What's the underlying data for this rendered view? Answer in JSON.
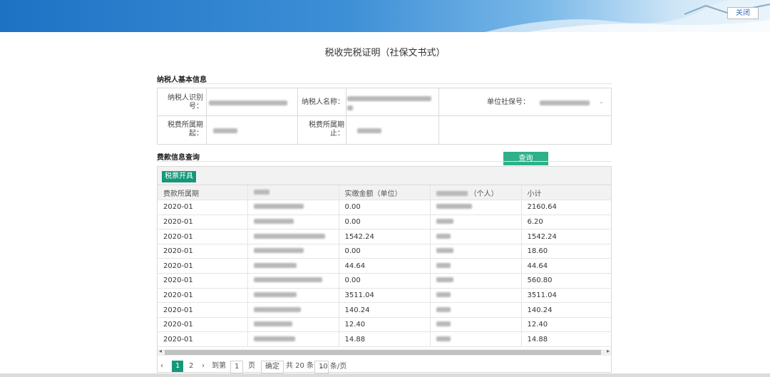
{
  "header": {
    "close_label": "关闭"
  },
  "page_title": "税收完税证明（社保文书式）",
  "taxpayer_section": {
    "title": "纳税人基本信息",
    "id_label": "纳税人识别号：",
    "name_label": "纳税人名称：",
    "social_no_label": "单位社保号：",
    "period_start_label": "税费所属期起：",
    "period_end_label": "税费所属期止：",
    "query_label": "查询"
  },
  "fee_section": {
    "title": "费款信息查询",
    "print_label": "税票开具",
    "columns": [
      "费款所属期",
      "险种",
      "实缴金额（单位）",
      "实缴金额（个人）",
      "小计"
    ],
    "rows": [
      {
        "period": "2020-01",
        "unit": "0.00",
        "subtotal": "2160.64"
      },
      {
        "period": "2020-01",
        "unit": "0.00",
        "subtotal": "6.20"
      },
      {
        "period": "2020-01",
        "unit": "1542.24",
        "subtotal": "1542.24"
      },
      {
        "period": "2020-01",
        "unit": "0.00",
        "subtotal": "18.60"
      },
      {
        "period": "2020-01",
        "unit": "44.64",
        "subtotal": "44.64"
      },
      {
        "period": "2020-01",
        "unit": "0.00",
        "subtotal": "560.80"
      },
      {
        "period": "2020-01",
        "unit": "3511.04",
        "subtotal": "3511.04"
      },
      {
        "period": "2020-01",
        "unit": "140.24",
        "subtotal": "140.24"
      },
      {
        "period": "2020-01",
        "unit": "12.40",
        "subtotal": "12.40"
      },
      {
        "period": "2020-01",
        "unit": "14.88",
        "subtotal": "14.88"
      }
    ]
  },
  "pager": {
    "prev": "‹",
    "page1": "1",
    "page2": "2",
    "next": "›",
    "goto_label": "到第",
    "goto_value": "1",
    "page_unit": "页",
    "confirm": "确定",
    "total": "共 20 条",
    "page_size": "10 条/页"
  }
}
